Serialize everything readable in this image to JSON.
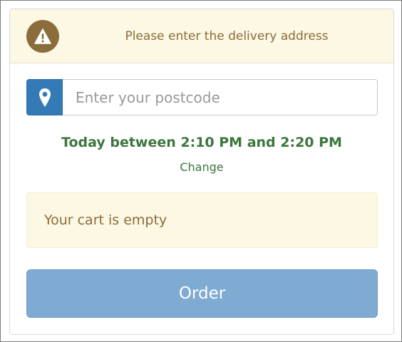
{
  "alert": {
    "icon": "warning-icon",
    "message": "Please enter the delivery address"
  },
  "postcode": {
    "icon": "map-marker-icon",
    "placeholder": "Enter your postcode",
    "value": ""
  },
  "delivery": {
    "time_text": "Today between 2:10 PM and 2:20 PM",
    "change_label": "Change"
  },
  "cart": {
    "empty_message": "Your cart is empty"
  },
  "order": {
    "button_label": "Order"
  },
  "colors": {
    "warning_bg": "#fcf8e3",
    "warning_text": "#8a6d3b",
    "success_text": "#3c763d",
    "primary": "#337ab7",
    "primary_disabled": "#7faad2"
  }
}
